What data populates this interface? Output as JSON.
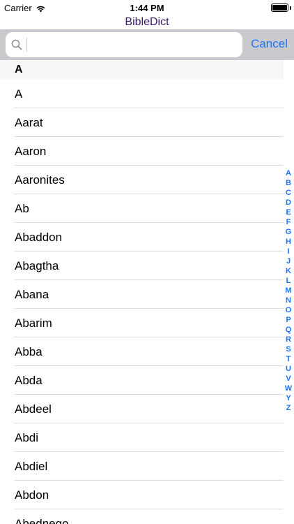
{
  "status_bar": {
    "carrier": "Carrier",
    "time": "1:44 PM",
    "icons": [
      "wifi-icon",
      "battery-icon"
    ]
  },
  "app": {
    "title": "BibleDict",
    "title_color": "#3c1a6b"
  },
  "search": {
    "value": "",
    "placeholder": "",
    "cancel_label": "Cancel",
    "accent": "#1e73ff"
  },
  "section": {
    "header": "A"
  },
  "list": {
    "items": [
      "A",
      "Aarat",
      "Aaron",
      "Aaronites",
      "Ab",
      "Abaddon",
      "Abagtha",
      "Abana",
      "Abarim",
      "Abba",
      "Abda",
      "Abdeel",
      "Abdi",
      "Abdiel",
      "Abdon",
      "Abednego"
    ]
  },
  "index": {
    "letters": [
      "A",
      "B",
      "C",
      "D",
      "E",
      "F",
      "G",
      "H",
      "I",
      "J",
      "K",
      "L",
      "M",
      "N",
      "O",
      "P",
      "Q",
      "R",
      "S",
      "T",
      "U",
      "V",
      "W",
      "Y",
      "Z"
    ]
  }
}
